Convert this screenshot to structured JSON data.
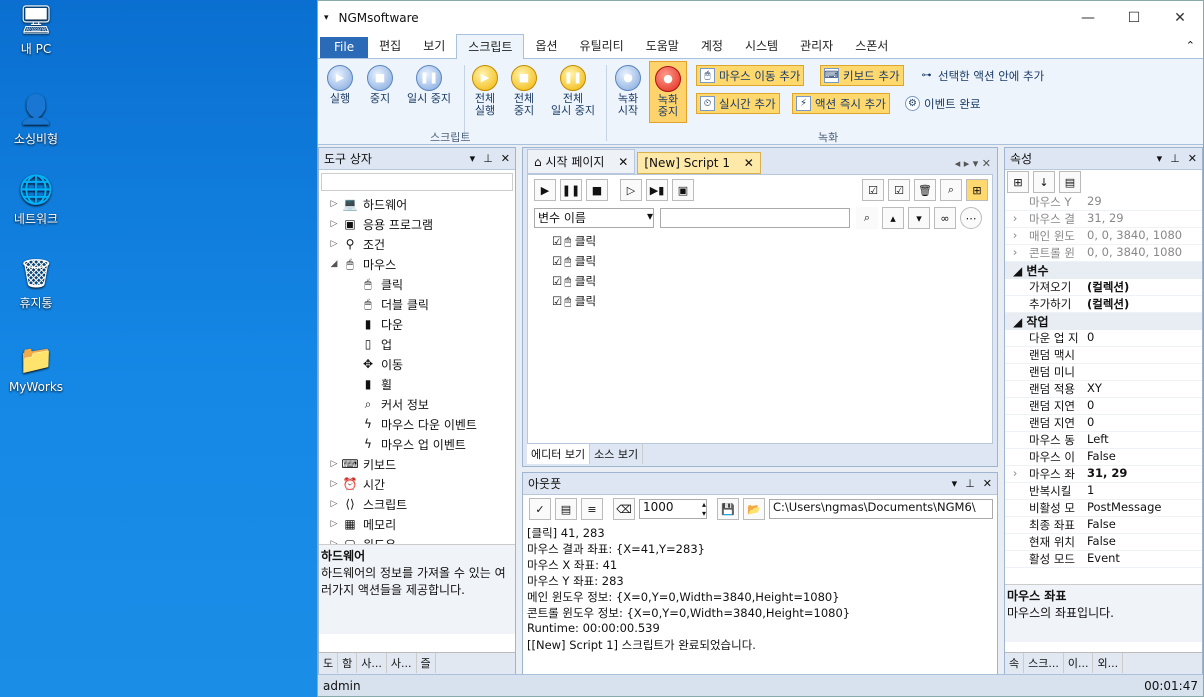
{
  "desktop": [
    {
      "label": "내 PC",
      "icon": "pc-icon",
      "glyph": "🖥"
    },
    {
      "label": "소싱비형",
      "icon": "user-folder-icon",
      "glyph": "👤"
    },
    {
      "label": "네트워크",
      "icon": "network-icon",
      "glyph": "🌐"
    },
    {
      "label": "휴지통",
      "icon": "recycle-bin-icon",
      "glyph": "🗑"
    },
    {
      "label": "MyWorks",
      "icon": "folder-icon",
      "glyph": "📁"
    }
  ],
  "window": {
    "title": "NGMsoftware",
    "min": "—",
    "max": "☐",
    "close": "✕"
  },
  "menu": [
    "File",
    "편집",
    "보기",
    "스크립트",
    "옵션",
    "유틸리티",
    "도움말",
    "계정",
    "시스템",
    "관리자",
    "스폰서"
  ],
  "ribbon": {
    "run": "실행",
    "stop": "중지",
    "pause": "일시 중지",
    "all_run_1": "전체",
    "all_run_2": "실행",
    "all_stop_1": "전체",
    "all_stop_2": "중지",
    "all_pause_1": "전체",
    "all_pause_2": "일시 중지",
    "group_script": "스크립트",
    "rec_start_1": "녹화",
    "rec_start_2": "시작",
    "rec_stop_1": "녹화",
    "rec_stop_2": "중지",
    "mouse_move": "마우스 이동 추가",
    "keyboard": "키보드 추가",
    "selected": "선택한 액션 안에 추가",
    "realtime": "실시간 추가",
    "instant": "액션 즉시 추가",
    "event_done": "이벤트 완료",
    "group_rec": "녹화"
  },
  "toolbox": {
    "title": "도구 상자",
    "items": [
      {
        "label": "하드웨어",
        "icon": "💻",
        "exp": "▷"
      },
      {
        "label": "응용 프로그램",
        "icon": "▣",
        "exp": "▷"
      },
      {
        "label": "조건",
        "icon": "⚲",
        "exp": "▷"
      },
      {
        "label": "마우스",
        "icon": "🖱",
        "exp": "◢"
      },
      {
        "label": "클릭",
        "icon": "🖱",
        "exp": "",
        "sub": true
      },
      {
        "label": "더블 클릭",
        "icon": "🖱",
        "exp": "",
        "sub": true
      },
      {
        "label": "다운",
        "icon": "▮",
        "exp": "",
        "sub": true
      },
      {
        "label": "업",
        "icon": "▯",
        "exp": "",
        "sub": true
      },
      {
        "label": "이동",
        "icon": "✥",
        "exp": "",
        "sub": true
      },
      {
        "label": "휠",
        "icon": "▮",
        "exp": "",
        "sub": true
      },
      {
        "label": "커서 정보",
        "icon": "⌕",
        "exp": "",
        "sub": true
      },
      {
        "label": "마우스 다운 이벤트",
        "icon": "ϟ",
        "exp": "",
        "sub": true
      },
      {
        "label": "마우스 업 이벤트",
        "icon": "ϟ",
        "exp": "",
        "sub": true
      },
      {
        "label": "키보드",
        "icon": "⌨",
        "exp": "▷"
      },
      {
        "label": "시간",
        "icon": "⏰",
        "exp": "▷"
      },
      {
        "label": "스크립트",
        "icon": "⟨⟩",
        "exp": "▷"
      },
      {
        "label": "메모리",
        "icon": "▦",
        "exp": "▷"
      },
      {
        "label": "윈도우",
        "icon": "▢",
        "exp": "▷"
      }
    ],
    "desc_title": "하드웨어",
    "desc": "하드웨어의 정보를 가져올 수 있는 여러가지 액션들을 제공합니다.",
    "tabs": [
      "도",
      "함",
      "사...",
      "사...",
      "즐"
    ]
  },
  "editor": {
    "tab_start": "시작 페이지",
    "tab_script": "[New] Script 1",
    "var_select": "변수 이름",
    "rows": [
      "클릭",
      "클릭",
      "클릭",
      "클릭"
    ],
    "view_editor": "에디터 보기",
    "view_source": "소스 보기"
  },
  "output": {
    "title": "아웃풋",
    "count": "1000",
    "path": "C:\\Users\\ngmas\\Documents\\NGM6\\",
    "lines": [
      "[클릭] 41, 283",
      "마우스 결과 좌표: {X=41,Y=283}",
      "마우스 X 좌표: 41",
      "마우스 Y 좌표: 283",
      "메인 윈도우 정보: {X=0,Y=0,Width=3840,Height=1080}",
      "콘트롤 윈도우 정보: {X=0,Y=0,Width=3840,Height=1080}",
      "Runtime: 00:00:00.539",
      "[[New] Script 1] 스크립트가 완료되었습니다."
    ]
  },
  "props": {
    "title": "속성",
    "rows": [
      {
        "k": "마우스 Y",
        "v": "29",
        "g": 1
      },
      {
        "k": "마우스 결",
        "v": "31, 29",
        "g": 1,
        "e": 1
      },
      {
        "k": "매인 윈도",
        "v": "0, 0, 3840, 1080",
        "g": 1,
        "e": 1
      },
      {
        "k": "콘트롤 윈",
        "v": "0, 0, 3840, 1080",
        "g": 1,
        "e": 1
      },
      {
        "cat": "변수"
      },
      {
        "k": "가져오기",
        "v": "(컬렉션)",
        "b": 1
      },
      {
        "k": "추가하기",
        "v": "(컬렉션)",
        "b": 1
      },
      {
        "cat": "작업"
      },
      {
        "k": "다운 업 지",
        "v": "0"
      },
      {
        "k": "랜덤 맥시",
        "v": ""
      },
      {
        "k": "랜덤 미니",
        "v": ""
      },
      {
        "k": "랜덤 적용",
        "v": "XY"
      },
      {
        "k": "랜덤 지연",
        "v": "0"
      },
      {
        "k": "랜덤 지연",
        "v": "0"
      },
      {
        "k": "마우스 동",
        "v": "Left"
      },
      {
        "k": "마우스 이",
        "v": "False"
      },
      {
        "k": "마우스 좌",
        "v": "31, 29",
        "b": 1,
        "e": 1
      },
      {
        "k": "반복시킬",
        "v": "1"
      },
      {
        "k": "비활성 모",
        "v": "PostMessage"
      },
      {
        "k": "최종 좌표",
        "v": "False"
      },
      {
        "k": "현재 위치",
        "v": "False"
      },
      {
        "k": "활성 모드",
        "v": "Event"
      }
    ],
    "desc_title": "마우스 좌표",
    "desc": "마우스의 좌표입니다.",
    "tabs": [
      "속",
      "스크...",
      "이...",
      "외..."
    ]
  },
  "status": {
    "user": "admin",
    "time": "00:01:47"
  }
}
